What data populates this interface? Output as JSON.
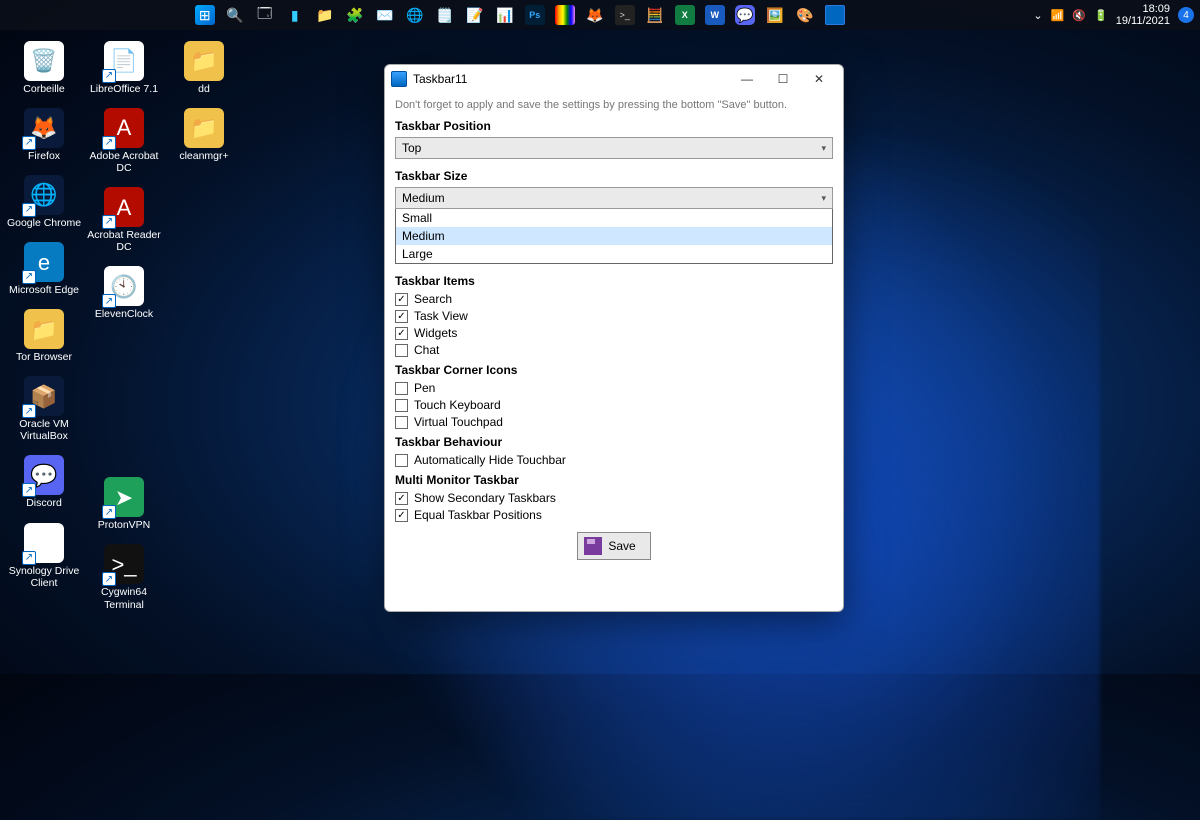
{
  "taskbar": {
    "system_tray": {
      "time": "18:09",
      "date": "19/11/2021",
      "badge": "4"
    }
  },
  "desktop_icons": {
    "col1": [
      {
        "label": "Corbeille",
        "bg": "#fff",
        "emoji": "🗑️"
      },
      {
        "label": "Firefox",
        "bg": "#0a1a3a",
        "emoji": "🦊"
      },
      {
        "label": "Google Chrome",
        "bg": "#0a1a3a",
        "emoji": "🌐"
      },
      {
        "label": "Microsoft Edge",
        "bg": "#067bc2",
        "emoji": "e"
      },
      {
        "label": "Tor Browser",
        "bg": "#f0c24b",
        "emoji": "📁"
      },
      {
        "label": "Oracle VM VirtualBox",
        "bg": "#0a1a3a",
        "emoji": "📦"
      },
      {
        "label": "Discord",
        "bg": "#5865f2",
        "emoji": "💬"
      },
      {
        "label": "Synology Drive Client",
        "bg": "#fff",
        "emoji": "➲"
      }
    ],
    "col2": [
      {
        "label": "LibreOffice 7.1",
        "bg": "#fff",
        "emoji": "📄"
      },
      {
        "label": "Adobe Acrobat DC",
        "bg": "#b30b00",
        "emoji": "A"
      },
      {
        "label": "Acrobat Reader DC",
        "bg": "#b30b00",
        "emoji": "A"
      },
      {
        "label": "ElevenClock",
        "bg": "#fff",
        "emoji": "🕙"
      },
      {
        "label": "",
        "bg": "transparent",
        "emoji": ""
      },
      {
        "label": "",
        "bg": "transparent",
        "emoji": ""
      },
      {
        "label": "ProtonVPN",
        "bg": "#1fa05a",
        "emoji": "➤"
      },
      {
        "label": "Cygwin64 Terminal",
        "bg": "#111",
        "emoji": ">_"
      }
    ],
    "col3": [
      {
        "label": "dd",
        "bg": "#f0c24b",
        "emoji": "📁"
      },
      {
        "label": "cleanmgr+",
        "bg": "#f0c24b",
        "emoji": "📁"
      }
    ]
  },
  "window": {
    "title": "Taskbar11",
    "hint": "Don't forget to apply and save the settings by pressing the bottom \"Save\" button.",
    "sections": {
      "position": {
        "heading": "Taskbar Position",
        "selected": "Top"
      },
      "size": {
        "heading": "Taskbar Size",
        "selected": "Medium",
        "options": [
          "Small",
          "Medium",
          "Large"
        ]
      },
      "items": {
        "heading": "Taskbar Items",
        "list": [
          {
            "label": "Search",
            "checked": true
          },
          {
            "label": "Task View",
            "checked": true
          },
          {
            "label": "Widgets",
            "checked": true
          },
          {
            "label": "Chat",
            "checked": false
          }
        ]
      },
      "corner": {
        "heading": "Taskbar Corner Icons",
        "list": [
          {
            "label": "Pen",
            "checked": false
          },
          {
            "label": "Touch Keyboard",
            "checked": false
          },
          {
            "label": "Virtual Touchpad",
            "checked": false
          }
        ]
      },
      "behaviour": {
        "heading": "Taskbar Behaviour",
        "list": [
          {
            "label": "Automatically Hide Touchbar",
            "checked": false
          }
        ]
      },
      "multimon": {
        "heading": "Multi Monitor Taskbar",
        "list": [
          {
            "label": "Show Secondary Taskbars",
            "checked": true
          },
          {
            "label": "Equal Taskbar Positions",
            "checked": true
          }
        ]
      }
    },
    "save_label": "Save"
  }
}
